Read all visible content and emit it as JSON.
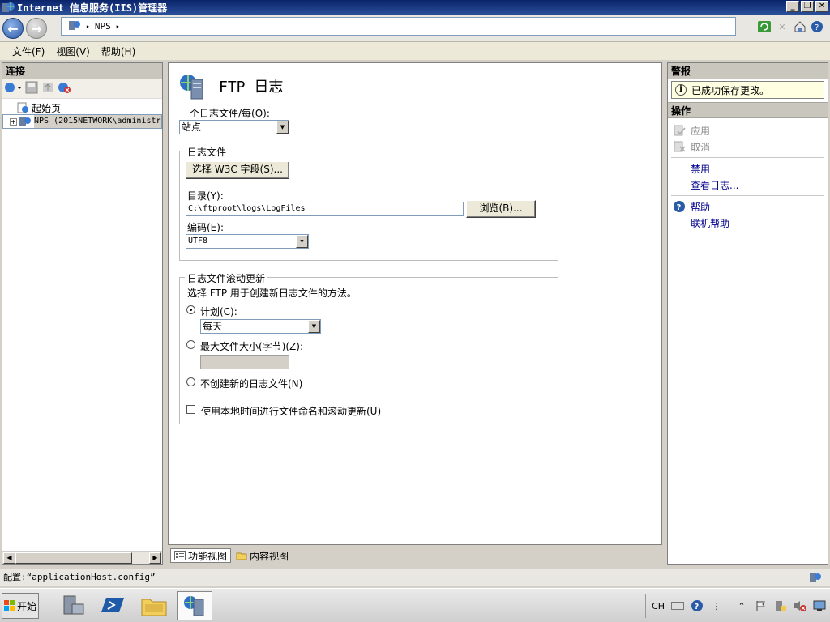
{
  "window": {
    "title": "Internet 信息服务(IIS)管理器",
    "minimize": "_",
    "restore": "❐",
    "close": "✕"
  },
  "address": {
    "crumb": "NPS",
    "sep1": "▸",
    "sep2": "▸"
  },
  "menu": {
    "file": "文件(F)",
    "view": "视图(V)",
    "help": "帮助(H)"
  },
  "connections": {
    "header": "连接",
    "tree": [
      {
        "label": "起始页"
      },
      {
        "label": "NPS (2015NETWORK\\administr",
        "expander": "+"
      }
    ]
  },
  "page": {
    "title": "FTP 日志",
    "one_log_per_label": "一个日志文件/每(O):",
    "one_log_per_value": "站点",
    "log_file_group": "日志文件",
    "select_fields_button": "选择 W3C 字段(S)...",
    "directory_label": "目录(Y):",
    "directory_value": "C:\\ftproot\\logs\\LogFiles",
    "browse_button": "浏览(B)...",
    "encoding_label": "编码(E):",
    "encoding_value": "UTF8",
    "rollover_group": "日志文件滚动更新",
    "rollover_desc": "选择 FTP 用于创建新日志文件的方法。",
    "schedule_label": "计划(C):",
    "schedule_value": "每天",
    "max_size_label": "最大文件大小(字节)(Z):",
    "no_new_label": "不创建新的日志文件(N)",
    "local_time_label": "使用本地时间进行文件命名和滚动更新(U)"
  },
  "view_tabs": {
    "features": "功能视图",
    "content": "内容视图"
  },
  "alerts": {
    "header": "警报",
    "message": "已成功保存更改。"
  },
  "actions": {
    "header": "操作",
    "apply": "应用",
    "cancel": "取消",
    "disable": "禁用",
    "view_logs": "查看日志...",
    "help": "帮助",
    "online_help": "联机帮助"
  },
  "status": {
    "text": "配置:“applicationHost.config”"
  },
  "taskbar": {
    "start": "开始",
    "lang": "CH"
  }
}
